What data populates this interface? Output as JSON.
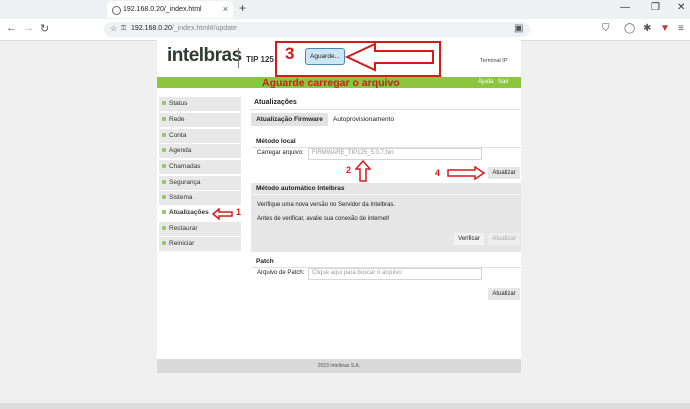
{
  "browser": {
    "tab_title": "192.168.0.20/_index.html",
    "url_host": "192.168.0.20",
    "url_path": "/_index.html#/update",
    "new_tab": "+",
    "tab_close": "×",
    "window_controls": [
      "—",
      "❐",
      "✕"
    ],
    "nav": [
      "←",
      "→",
      "↻"
    ]
  },
  "header": {
    "logo": "intelbras",
    "model": "TIP 125",
    "terminal_ip": "Terminal IP",
    "links": [
      "Ajuda",
      "Sair"
    ]
  },
  "sidebar": {
    "items": [
      {
        "label": "Status"
      },
      {
        "label": "Rede"
      },
      {
        "label": "Conta"
      },
      {
        "label": "Agenda"
      },
      {
        "label": "Chamadas"
      },
      {
        "label": "Segurança"
      },
      {
        "label": "Sistema"
      },
      {
        "label": "Atualizações",
        "active": true
      },
      {
        "label": "Restaurar"
      },
      {
        "label": "Reiniciar"
      }
    ]
  },
  "main": {
    "title": "Atualizações",
    "tabs": [
      "Atualização Firmware",
      "Autoprovisionamento"
    ],
    "local": {
      "title": "Método local",
      "label": "Carregar arquivo:",
      "file_value": "FIRMWARE_TIP125_5.0.7.bin",
      "button": "Atualizar"
    },
    "auto": {
      "title": "Método automático Intelbras",
      "line1": "Verifique uma nova versão no Servidor da Intelbras.",
      "line2": "Antes de verificar, avalie sua conexão de internet!",
      "verify_button": "Verificar",
      "update_button": "Atualizar"
    },
    "patch": {
      "title": "Patch",
      "label": "Arquivo de Patch:",
      "placeholder": "Clique aqui para buscar o arquivo",
      "button": "Atualizar"
    },
    "footer": "2023 Intelbras S.A."
  },
  "annotations": {
    "n1": "1",
    "n2": "2",
    "n3": "3",
    "n4": "4",
    "wait_button": "Aguarde...",
    "message": "Aguarde carregar o arquivo"
  },
  "colors": {
    "green": "#8cc63f",
    "annotation_red": "#d61a1a"
  }
}
